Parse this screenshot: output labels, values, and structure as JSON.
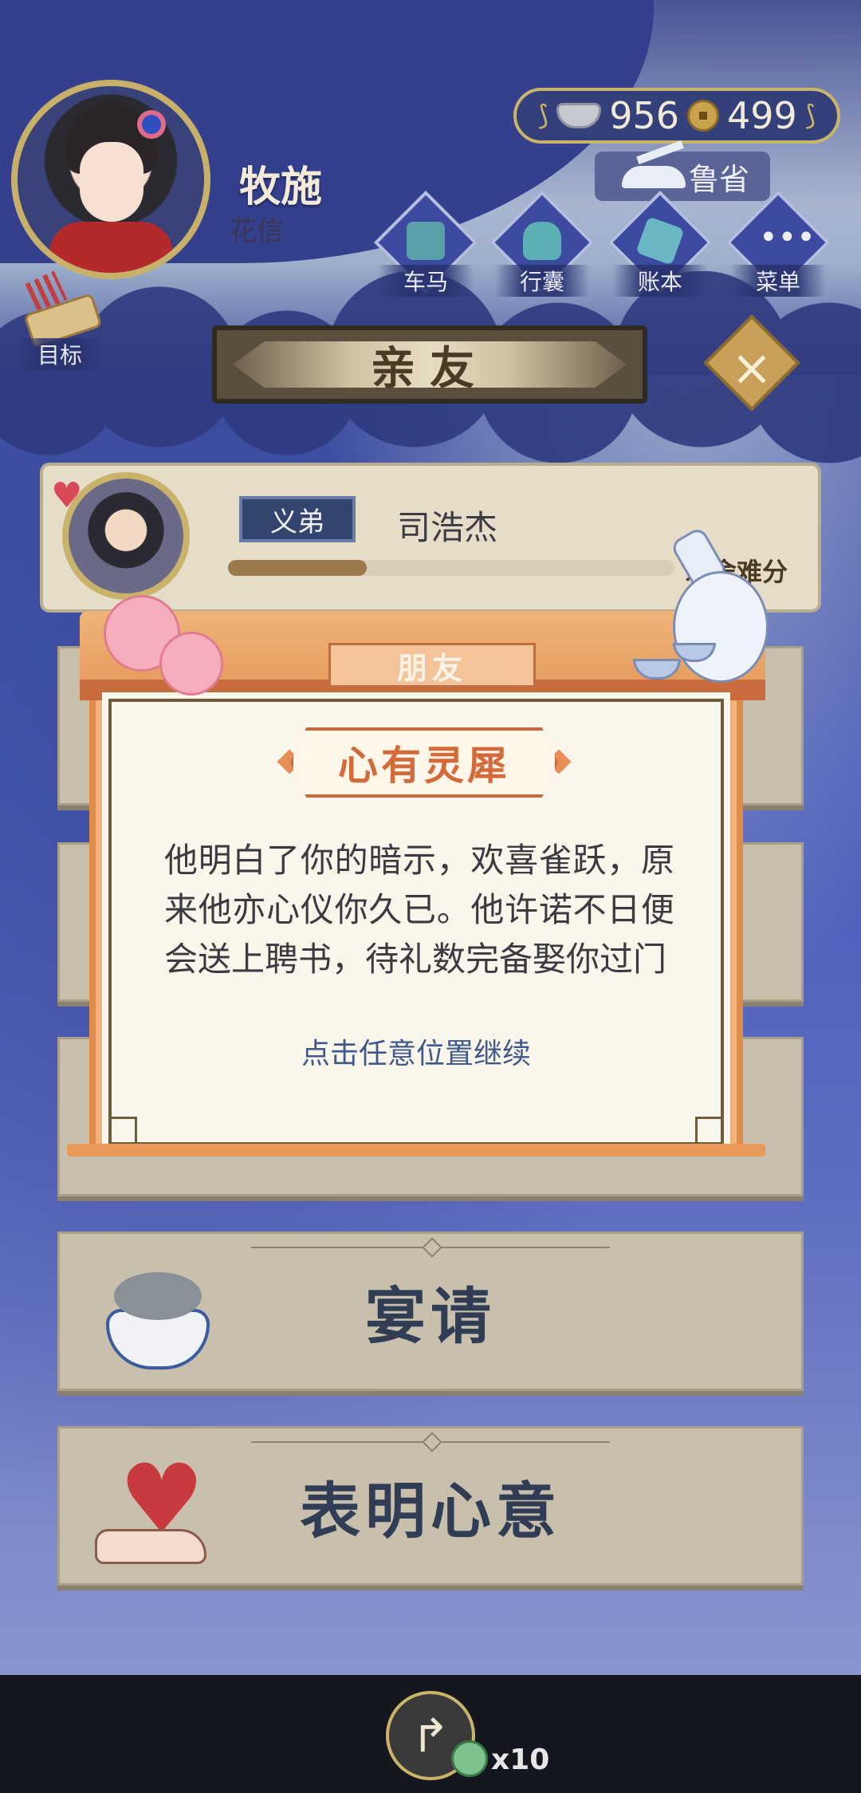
{
  "player": {
    "name": "牧施",
    "status": "花信"
  },
  "currency": {
    "silver": "956",
    "copper": "499"
  },
  "location": {
    "name": "鲁省"
  },
  "nav": {
    "items": [
      {
        "label": "车马",
        "icon": "carriage-icon"
      },
      {
        "label": "行囊",
        "icon": "bag-icon"
      },
      {
        "label": "账本",
        "icon": "ledger-icon"
      },
      {
        "label": "菜单",
        "icon": "menu-icon"
      }
    ],
    "goal_label": "目标"
  },
  "page": {
    "title": "亲友"
  },
  "friend": {
    "relation": "义弟",
    "name": "司浩杰",
    "affinity_label": "难舍难分",
    "affinity_fraction": 0.31
  },
  "actions": [
    {
      "label": "宴请",
      "icon": "fish-bowl-icon"
    },
    {
      "label": "表明心意",
      "icon": "heart-hand-icon"
    }
  ],
  "modal": {
    "tab": "朋友",
    "title": "心有灵犀",
    "message": "他明白了你的暗示，欢喜雀跃，原来他亦心仪你久已。他许诺不日便会送上聘书，待礼数完备娶你过门",
    "hint": "点击任意位置继续"
  },
  "bottom": {
    "share_count": "x10"
  },
  "colors": {
    "background": "#3d4aa0",
    "modal_accent": "#e59a5c",
    "title_orange": "#d46a3a",
    "hint_blue": "#3f5a88"
  }
}
